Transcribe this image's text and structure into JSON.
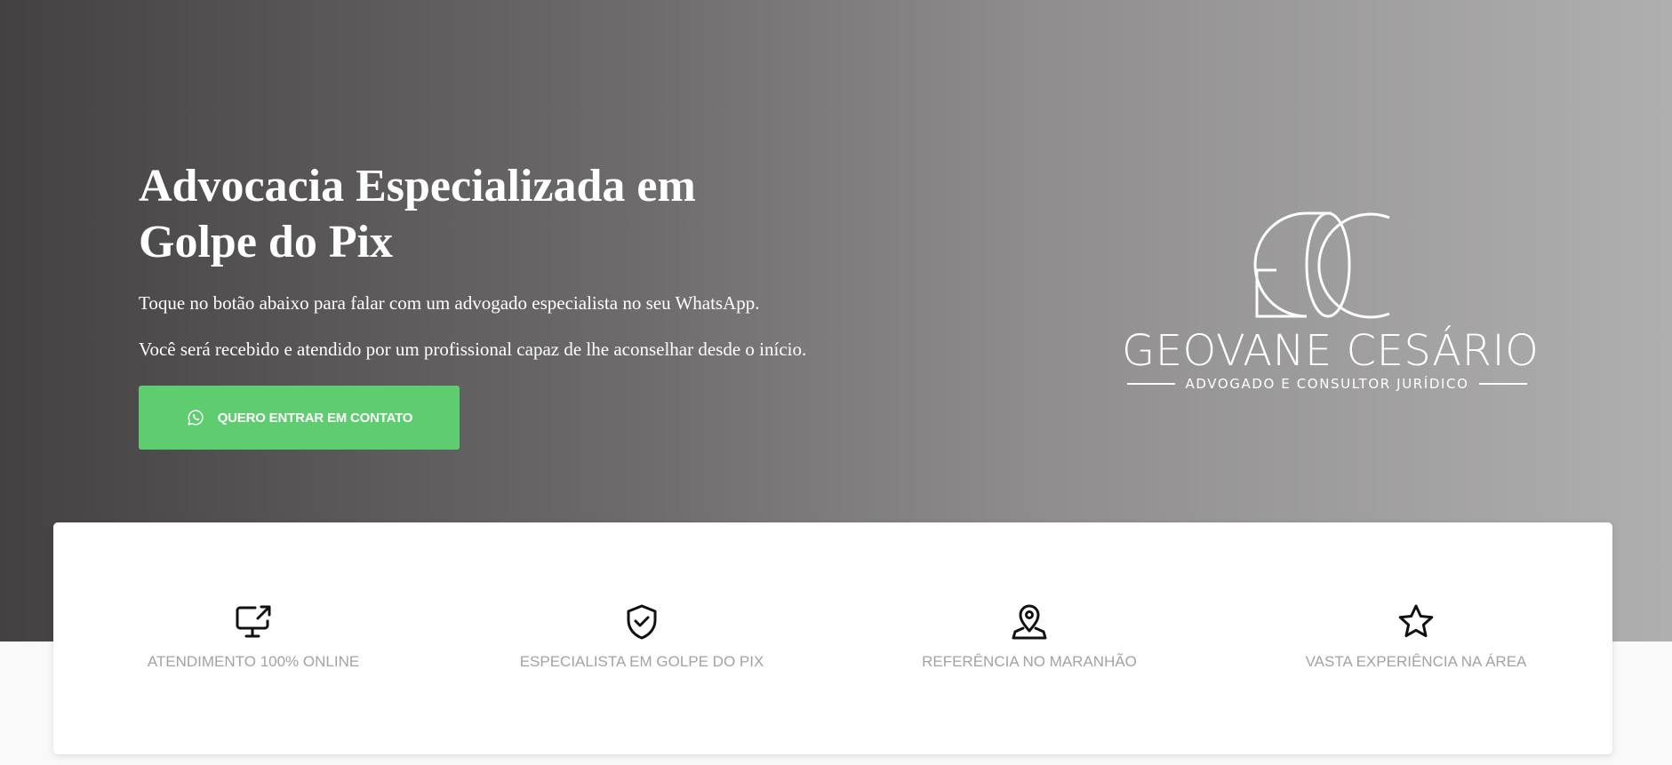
{
  "hero": {
    "title": "Advocacia Especializada em Golpe do Pix",
    "paragraph_1": "Toque no botão abaixo para falar com um advogado especialista no seu WhatsApp.",
    "paragraph_2": "Você será recebido e atendido por um profissional capaz de lhe aconselhar desde o início.",
    "cta": {
      "label": "QUERO ENTRAR EM CONTATO",
      "icon": "whatsapp-icon",
      "color": "#5ecd6f"
    }
  },
  "logo": {
    "monogram": "GC",
    "name": "GEOVANE CESÁRIO",
    "tagline": "ADVOGADO E CONSULTOR JURÍDICO"
  },
  "features": [
    {
      "label": "ATENDIMENTO 100% ONLINE",
      "icon": "monitor-share-icon"
    },
    {
      "label": "ESPECIALISTA EM GOLPE DO PIX",
      "icon": "shield-check-icon"
    },
    {
      "label": "REFERÊNCIA NO MARANHÃO",
      "icon": "map-pin-icon"
    },
    {
      "label": "VASTA EXPERIÊNCIA NA ÁREA",
      "icon": "star-icon"
    }
  ],
  "colors": {
    "hero_gradient_start": "#434142",
    "hero_gradient_end": "#b0afb0",
    "cta_green": "#5ecd6f",
    "feature_text": "#a3a3a3"
  }
}
